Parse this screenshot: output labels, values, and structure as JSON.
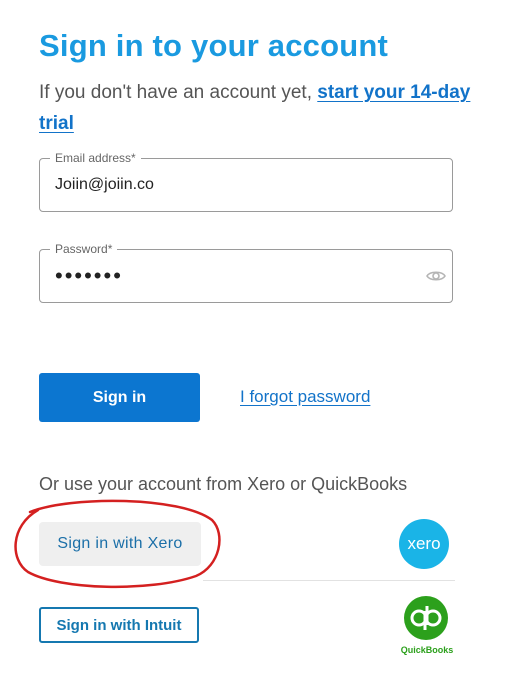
{
  "title": "Sign in to your account",
  "subtitle": {
    "text": "If you don't have an account yet, ",
    "link": "start your 14-day trial"
  },
  "email": {
    "label": "Email address*",
    "value": "Joiin@joiin.co"
  },
  "password": {
    "label": "Password*",
    "value": "•••••••",
    "icon": "eye-icon"
  },
  "actions": {
    "sign_in": "Sign in",
    "forgot": "I forgot password"
  },
  "alternatives": {
    "heading": "Or use your account from Xero or QuickBooks",
    "xero_button": "Sign in with Xero",
    "xero_logo": "xero",
    "intuit_button": "Sign in with Intuit",
    "quickbooks_logo": "QuickBooks"
  },
  "colors": {
    "title": "#1a9ae0",
    "primary_button": "#0c76d0",
    "link": "#1273c9",
    "xero": "#1ab4e7",
    "quickbooks": "#2ca01c",
    "annotation": "#d42020"
  }
}
